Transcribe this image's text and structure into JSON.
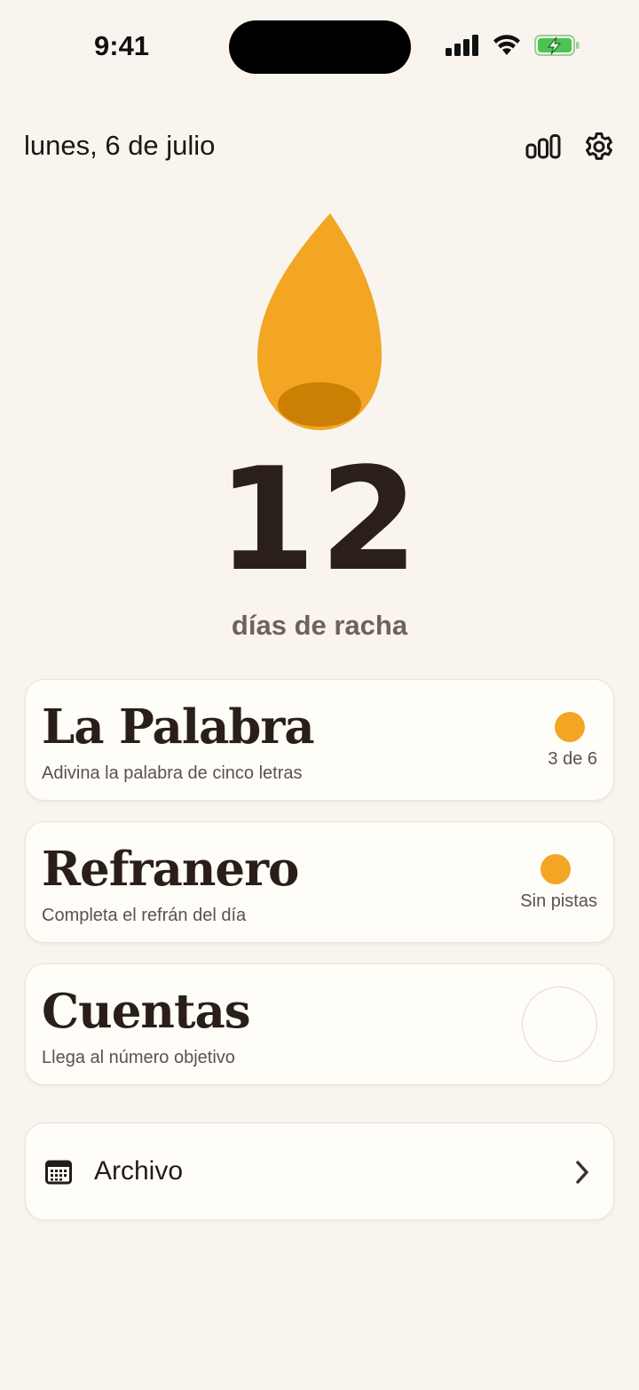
{
  "status_bar": {
    "time": "9:41"
  },
  "header": {
    "date": "lunes, 6 de julio",
    "stats_icon": "bar-chart-icon",
    "settings_icon": "gear-icon"
  },
  "streak": {
    "icon": "flame-icon",
    "count": "12",
    "label": "días de racha",
    "accent": "#f2a623"
  },
  "games": [
    {
      "title": "La Palabra",
      "subtitle": "Adivina la palabra de cinco letras",
      "status": "3 de 6",
      "completed": true
    },
    {
      "title": "Refranero",
      "subtitle": "Completa el refrán del día",
      "status": "Sin pistas",
      "completed": true
    },
    {
      "title": "Cuentas",
      "subtitle": "Llega al número objetivo",
      "status": "",
      "completed": false
    }
  ],
  "archive": {
    "label": "Archivo",
    "icon": "calendar-icon",
    "chevron": "chevron-right-icon"
  }
}
